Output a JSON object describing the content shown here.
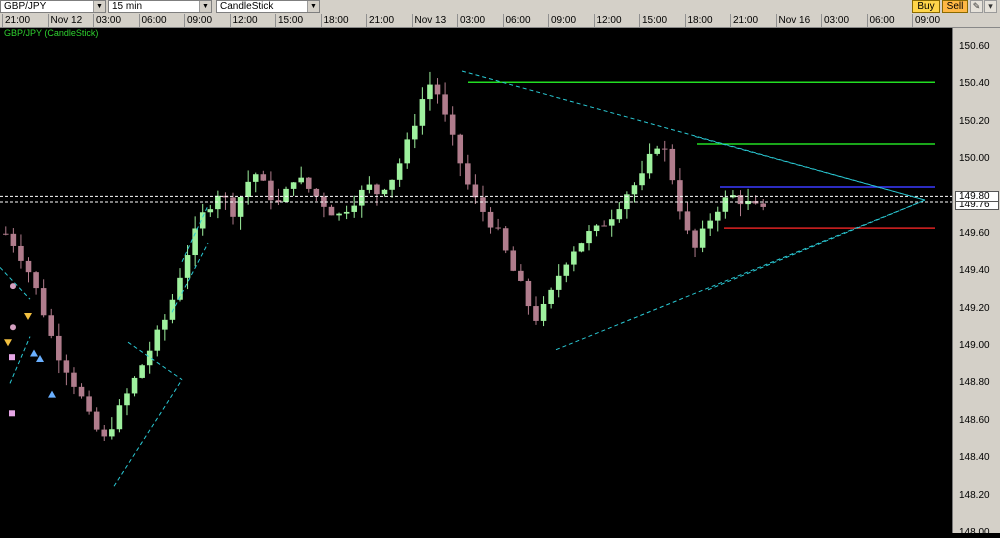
{
  "toolbar": {
    "symbol": "GBP/JPY",
    "timeframe": "15 min",
    "chart_type": "CandleStick",
    "buy_label": "Buy",
    "sell_label": "Sell",
    "buy_color": "#ffd54a",
    "sell_color": "#ffb845"
  },
  "time_axis": {
    "labels": [
      "21:00",
      "Nov 12",
      "03:00",
      "06:00",
      "09:00",
      "12:00",
      "15:00",
      "18:00",
      "21:00",
      "Nov 13",
      "03:00",
      "06:00",
      "09:00",
      "12:00",
      "15:00",
      "18:00",
      "21:00",
      "Nov 16",
      "03:00",
      "06:00",
      "09:00"
    ]
  },
  "chart_title": "GBP/JPY (CandleStick)",
  "price_axis": {
    "labels": [
      "150.60",
      "150.40",
      "150.20",
      "150.00",
      "149.80",
      "149.60",
      "149.40",
      "149.20",
      "149.00",
      "148.80",
      "148.60",
      "148.40",
      "148.20",
      "148.00"
    ],
    "current_price": "149.80",
    "secondary_price": "149.76"
  },
  "chart_data": {
    "type": "candlestick",
    "symbol": "GBP/JPY",
    "interval": "15 min",
    "ylim": [
      148.0,
      150.7
    ],
    "colors": {
      "up": "#9ef19e",
      "down": "#b07c8c",
      "background": "#000000"
    },
    "horizontal_lines": [
      {
        "price": 150.41,
        "color": "#22dd22"
      },
      {
        "price": 150.08,
        "color": "#22dd22"
      },
      {
        "price": 149.85,
        "color": "#3a3aff"
      },
      {
        "price": 149.63,
        "color": "#dd2222"
      },
      {
        "price": 149.8,
        "color": "#ffffff",
        "style": "dashed"
      },
      {
        "price": 149.77,
        "color": "#ffffff",
        "style": "dashed"
      }
    ],
    "series": [
      {
        "values": [
          149.6,
          149.55,
          149.48,
          149.4,
          149.3,
          149.18,
          149.05,
          148.95,
          148.88,
          148.8,
          148.72,
          148.62,
          148.55,
          148.5,
          148.58,
          148.66,
          148.74,
          148.82,
          148.9,
          148.98,
          149.06,
          149.14,
          149.25,
          149.38,
          149.5,
          149.6,
          149.7,
          149.76,
          149.82,
          149.78,
          149.72,
          149.8,
          149.88,
          149.92,
          149.86,
          149.8,
          149.76,
          149.82,
          149.9,
          149.88,
          149.84,
          149.8,
          149.76,
          149.72,
          149.7,
          149.74,
          149.78,
          149.82,
          149.85,
          149.82,
          149.86,
          149.9,
          149.98,
          150.08,
          150.2,
          150.32,
          150.4,
          150.35,
          150.22,
          150.1,
          149.98,
          149.86,
          149.78,
          149.72,
          149.66,
          149.6,
          149.5,
          149.4,
          149.32,
          149.22,
          149.15,
          149.2,
          149.28,
          149.38,
          149.46,
          149.52,
          149.56,
          149.6,
          149.62,
          149.66,
          149.7,
          149.76,
          149.82,
          149.86,
          149.9,
          150.0,
          150.08,
          150.04,
          149.9,
          149.74,
          149.6,
          149.52,
          149.6,
          149.68,
          149.74,
          149.78,
          149.8,
          149.78,
          149.76,
          149.74,
          149.72
        ]
      }
    ],
    "annotations": "triangle pattern trendlines (cyan dashed)"
  }
}
